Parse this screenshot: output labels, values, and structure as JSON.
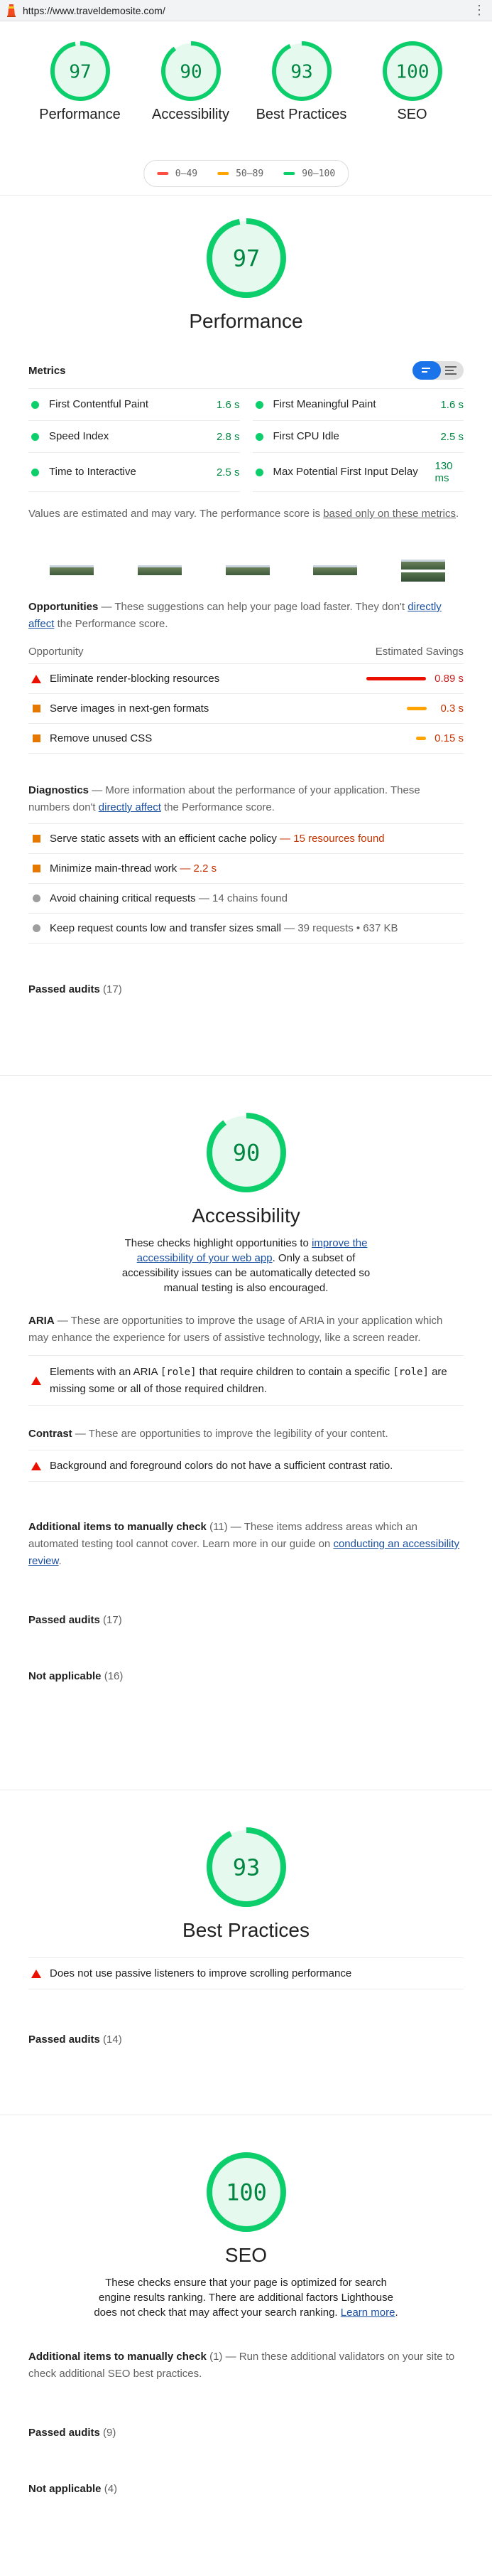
{
  "browser": {
    "url": "https://www.traveldemosite.com/",
    "menu_icon": "kebab-menu-icon"
  },
  "summary": {
    "gauges": [
      {
        "score": "97",
        "score_num": 97,
        "label": "Performance"
      },
      {
        "score": "90",
        "score_num": 90,
        "label": "Accessibility"
      },
      {
        "score": "93",
        "score_num": 93,
        "label": "Best Practices"
      },
      {
        "score": "100",
        "score_num": 100,
        "label": "SEO"
      }
    ],
    "legend": [
      {
        "range": "0–49",
        "color": "#ff4e42"
      },
      {
        "range": "50–89",
        "color": "#ffa400"
      },
      {
        "range": "90–100",
        "color": "#0cce6b"
      }
    ]
  },
  "colors": {
    "pass": "#0cce6b",
    "pass_text": "#018642",
    "average": "#ffa400",
    "fail": "#ff4e42",
    "link": "#1a4fa0"
  },
  "performance": {
    "score": "97",
    "title": "Performance",
    "metrics_label": "Metrics",
    "metrics": [
      {
        "name": "First Contentful Paint",
        "value": "1.6 s"
      },
      {
        "name": "First Meaningful Paint",
        "value": "1.6 s"
      },
      {
        "name": "Speed Index",
        "value": "2.8 s"
      },
      {
        "name": "First CPU Idle",
        "value": "2.5 s"
      },
      {
        "name": "Time to Interactive",
        "value": "2.5 s"
      },
      {
        "name": "Max Potential First Input Delay",
        "value": "130 ms"
      }
    ],
    "note_prefix": "Values are estimated and may vary. The performance score is ",
    "note_link": "based only on these metrics",
    "note_suffix": ".",
    "opportunities_label": "Opportunities",
    "opportunities_desc_prefix": " — These suggestions can help your page load faster. They don't ",
    "opportunities_desc_link": "directly affect",
    "opportunities_desc_suffix": " the Performance score.",
    "opp_col_left": "Opportunity",
    "opp_col_right": "Estimated Savings",
    "opportunities": [
      {
        "title": "Eliminate render-blocking resources",
        "savings": "0.89 s",
        "savings_num": 0.89,
        "severity": "fail"
      },
      {
        "title": "Serve images in next-gen formats",
        "savings": "0.3 s",
        "savings_num": 0.3,
        "severity": "average"
      },
      {
        "title": "Remove unused CSS",
        "savings": "0.15 s",
        "savings_num": 0.15,
        "severity": "average"
      }
    ],
    "diagnostics_label": "Diagnostics",
    "diagnostics_desc_prefix": " — More information about the performance of your application. These numbers don't ",
    "diagnostics_desc_link": "directly affect",
    "diagnostics_desc_suffix": " the Performance score.",
    "diagnostics": [
      {
        "title": "Serve static assets with an efficient cache policy",
        "detail": " — 15 resources found",
        "severity": "average"
      },
      {
        "title": "Minimize main-thread work",
        "detail": " — 2.2 s",
        "severity": "average"
      },
      {
        "title": "Avoid chaining critical requests",
        "detail": " — 14 chains found",
        "severity": "info"
      },
      {
        "title": "Keep request counts low and transfer sizes small",
        "detail": " — 39 requests • 637 KB",
        "severity": "info"
      }
    ],
    "passed_label": "Passed audits",
    "passed_count": " (17)"
  },
  "accessibility": {
    "score": "90",
    "title": "Accessibility",
    "desc_prefix": "These checks highlight opportunities to ",
    "desc_link": "improve the accessibility of your web app",
    "desc_suffix": ". Only a subset of accessibility issues can be automatically detected so manual testing is also encouraged.",
    "aria_label": "ARIA",
    "aria_desc": " — These are opportunities to improve the usage of ARIA in your application which may enhance the experience for users of assistive technology, like a screen reader.",
    "aria_audit_p1": "Elements with an ARIA ",
    "aria_audit_code1": "[role]",
    "aria_audit_p2": " that require children to contain a specific ",
    "aria_audit_code2": "[role]",
    "aria_audit_p3": " are missing some or all of those required children.",
    "contrast_label": "Contrast",
    "contrast_desc": " — These are opportunities to improve the legibility of your content.",
    "contrast_audit": "Background and foreground colors do not have a sufficient contrast ratio.",
    "manual_label": "Additional items to manually check",
    "manual_count": " (11)",
    "manual_desc": " — These items address areas which an automated testing tool cannot cover. Learn more in our guide on ",
    "manual_link": "conducting an accessibility review",
    "manual_suffix": ".",
    "passed_label": "Passed audits",
    "passed_count": " (17)",
    "na_label": "Not applicable",
    "na_count": " (16)"
  },
  "best_practices": {
    "score": "93",
    "title": "Best Practices",
    "audit": "Does not use passive listeners to improve scrolling performance",
    "passed_label": "Passed audits",
    "passed_count": " (14)"
  },
  "seo": {
    "score": "100",
    "title": "SEO",
    "desc": "These checks ensure that your page is optimized for search engine results ranking. There are additional factors Lighthouse does not check that may affect your search ranking. ",
    "desc_link": "Learn more",
    "desc_suffix": ".",
    "manual_label": "Additional items to manually check",
    "manual_count": " (1)",
    "manual_desc": " — Run these additional validators on your site to check additional SEO best practices.",
    "passed_label": "Passed audits",
    "passed_count": " (9)",
    "na_label": "Not applicable",
    "na_count": " (4)"
  }
}
